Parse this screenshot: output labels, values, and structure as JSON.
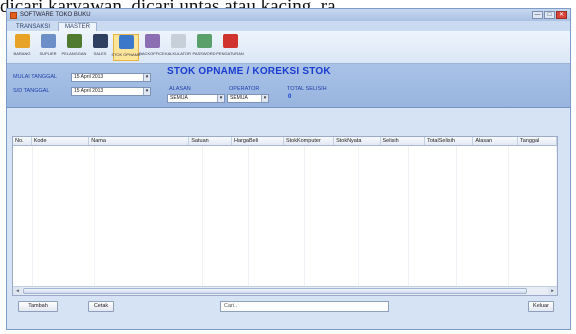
{
  "top_text": "dicari karyawan, dicari untas atau kacing, ra",
  "window": {
    "title": "SOFTWARE TOKO BUKU",
    "min": "—",
    "max": "□",
    "close": "✕"
  },
  "ribbon_tabs": [
    "TRANSAKSI",
    "MASTER"
  ],
  "ribbon_buttons": [
    {
      "label": "BARANG",
      "color": "#e6a326"
    },
    {
      "label": "SUPLIER",
      "color": "#6d8fc8"
    },
    {
      "label": "PELANGGAN",
      "color": "#4f7a2f"
    },
    {
      "label": "SALES",
      "color": "#2f3f60"
    },
    {
      "label": "STOK OPNAME",
      "color": "#3b78c9"
    },
    {
      "label": "BACKOFFICE",
      "color": "#8c6fb3"
    },
    {
      "label": "KALKULATOR",
      "color": "#c7cfd9"
    },
    {
      "label": "PASSWORD",
      "color": "#5aa06a"
    },
    {
      "label": "PENGATURAN",
      "color": "#d0322d"
    }
  ],
  "active_ribbon_button": 4,
  "filters": {
    "mulai_label": "MULAI TANGGAL",
    "mulai_value": "15 April 2013",
    "sd_label": "S/D TANGGAL",
    "sd_value": "15 April 2013",
    "alasan_label": "ALASAN",
    "alasan_value": "SEMUA",
    "operator_label": "OPERATOR",
    "operator_value": "SEMUA",
    "total_label": "TOTAL SELISIH",
    "total_value": "0"
  },
  "page_title": "STOK OPNAME / KOREKSI STOK",
  "columns": [
    "No.",
    "Kode",
    "Nama",
    "Satuan",
    "HargaBeli",
    "StokKomputer",
    "StokNyata",
    "Selisih",
    "TotalSelisih",
    "Alasan",
    "Tanggal"
  ],
  "buttons": {
    "tambah": "Tambah",
    "cetak": "Cetak",
    "keluar": "Keluar"
  },
  "search": {
    "value": "Cari.."
  },
  "colors": {
    "accent": "#1a3ccf",
    "panel": "#a9c2e6",
    "window": "#d6e3f4"
  }
}
